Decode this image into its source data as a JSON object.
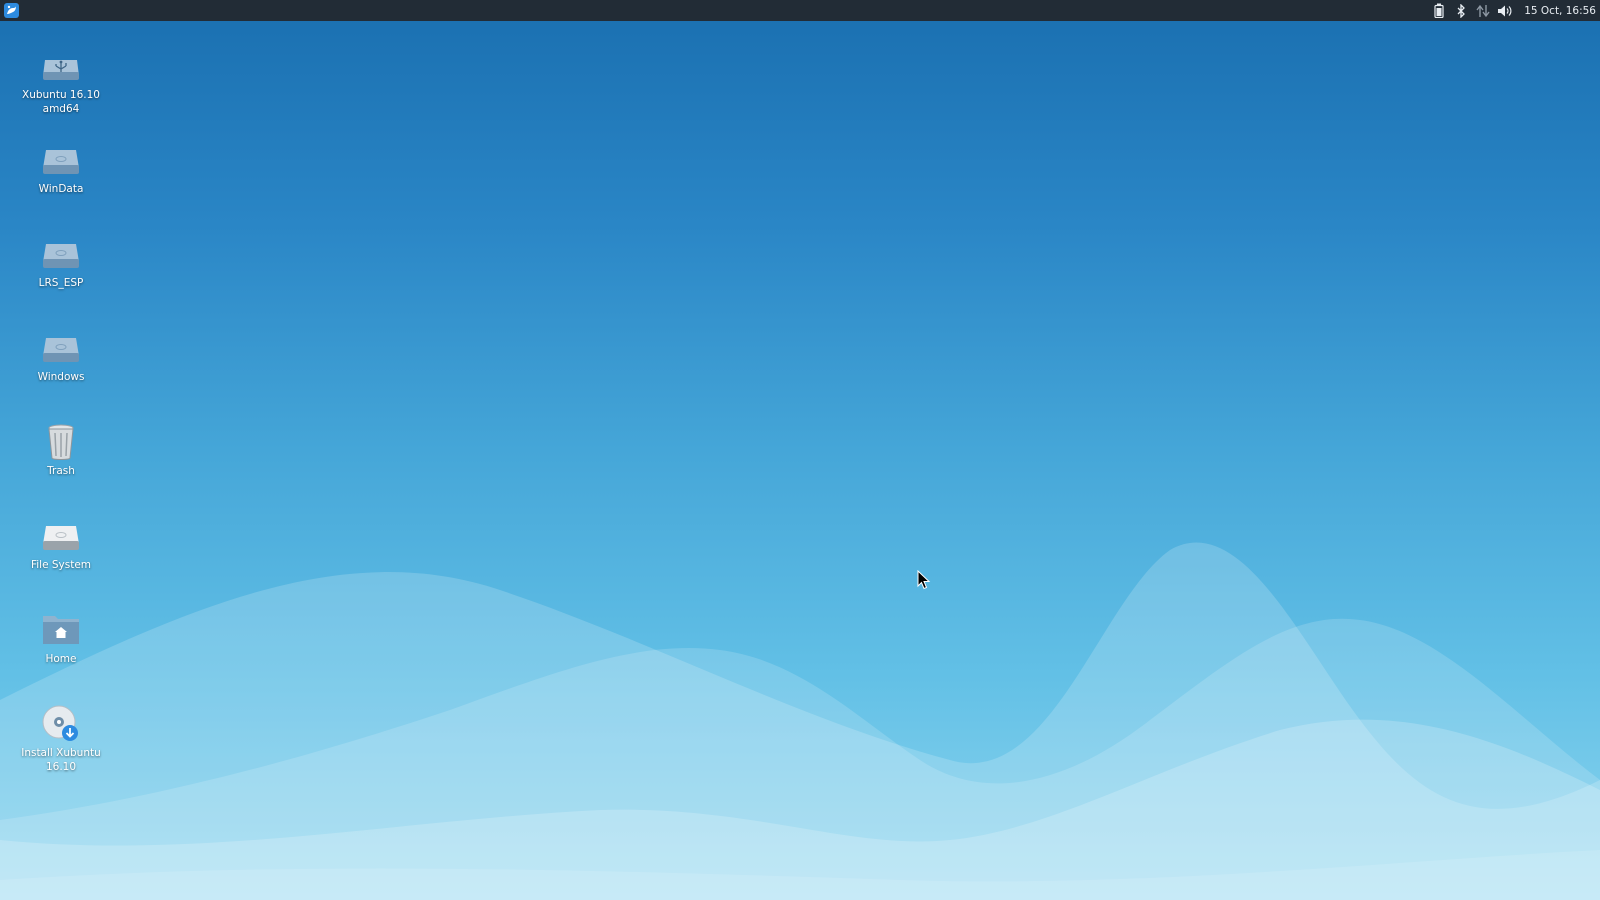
{
  "panel": {
    "menu_icon": "xfce-whisker-menu-icon",
    "tray_icons": [
      "battery-icon",
      "bluetooth-icon",
      "network-icon",
      "volume-icon"
    ],
    "clock": "15 Oct, 16:56"
  },
  "desktop": {
    "icons": [
      {
        "label": "Xubuntu 16.10 amd64",
        "icon": "usb-drive-icon"
      },
      {
        "label": "WinData",
        "icon": "hard-drive-icon"
      },
      {
        "label": "LRS_ESP",
        "icon": "hard-drive-icon"
      },
      {
        "label": "Windows",
        "icon": "hard-drive-icon"
      },
      {
        "label": "Trash",
        "icon": "trash-icon"
      },
      {
        "label": "File System",
        "icon": "file-system-icon"
      },
      {
        "label": "Home",
        "icon": "home-folder-icon"
      },
      {
        "label": "Install Xubuntu 16.10",
        "icon": "install-disc-icon"
      }
    ]
  },
  "colors": {
    "panel_bg": "#222c36",
    "wallpaper_top": "#1a6fb0",
    "wallpaper_bottom": "#8fd6ef"
  }
}
